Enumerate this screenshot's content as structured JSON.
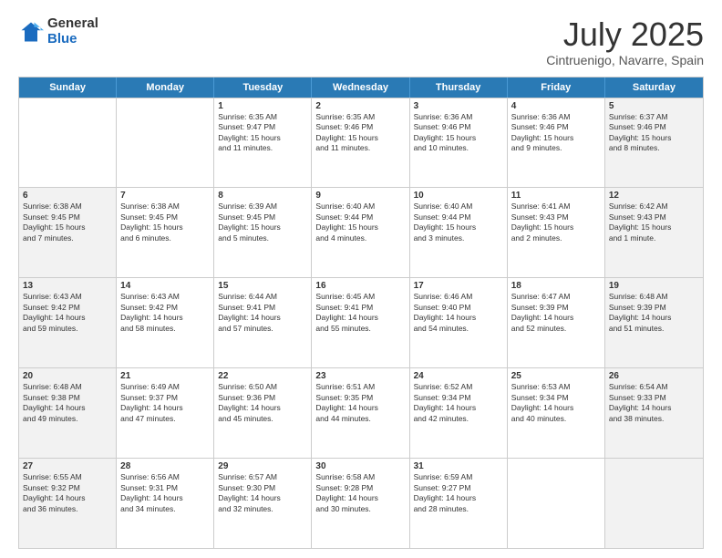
{
  "logo": {
    "general": "General",
    "blue": "Blue"
  },
  "title": "July 2025",
  "subtitle": "Cintruenigo, Navarre, Spain",
  "weekdays": [
    "Sunday",
    "Monday",
    "Tuesday",
    "Wednesday",
    "Thursday",
    "Friday",
    "Saturday"
  ],
  "weeks": [
    [
      {
        "day": "",
        "info": "",
        "shaded": false
      },
      {
        "day": "",
        "info": "",
        "shaded": false
      },
      {
        "day": "1",
        "info": "Sunrise: 6:35 AM\nSunset: 9:47 PM\nDaylight: 15 hours\nand 11 minutes.",
        "shaded": false
      },
      {
        "day": "2",
        "info": "Sunrise: 6:35 AM\nSunset: 9:46 PM\nDaylight: 15 hours\nand 11 minutes.",
        "shaded": false
      },
      {
        "day": "3",
        "info": "Sunrise: 6:36 AM\nSunset: 9:46 PM\nDaylight: 15 hours\nand 10 minutes.",
        "shaded": false
      },
      {
        "day": "4",
        "info": "Sunrise: 6:36 AM\nSunset: 9:46 PM\nDaylight: 15 hours\nand 9 minutes.",
        "shaded": false
      },
      {
        "day": "5",
        "info": "Sunrise: 6:37 AM\nSunset: 9:46 PM\nDaylight: 15 hours\nand 8 minutes.",
        "shaded": true
      }
    ],
    [
      {
        "day": "6",
        "info": "Sunrise: 6:38 AM\nSunset: 9:45 PM\nDaylight: 15 hours\nand 7 minutes.",
        "shaded": true
      },
      {
        "day": "7",
        "info": "Sunrise: 6:38 AM\nSunset: 9:45 PM\nDaylight: 15 hours\nand 6 minutes.",
        "shaded": false
      },
      {
        "day": "8",
        "info": "Sunrise: 6:39 AM\nSunset: 9:45 PM\nDaylight: 15 hours\nand 5 minutes.",
        "shaded": false
      },
      {
        "day": "9",
        "info": "Sunrise: 6:40 AM\nSunset: 9:44 PM\nDaylight: 15 hours\nand 4 minutes.",
        "shaded": false
      },
      {
        "day": "10",
        "info": "Sunrise: 6:40 AM\nSunset: 9:44 PM\nDaylight: 15 hours\nand 3 minutes.",
        "shaded": false
      },
      {
        "day": "11",
        "info": "Sunrise: 6:41 AM\nSunset: 9:43 PM\nDaylight: 15 hours\nand 2 minutes.",
        "shaded": false
      },
      {
        "day": "12",
        "info": "Sunrise: 6:42 AM\nSunset: 9:43 PM\nDaylight: 15 hours\nand 1 minute.",
        "shaded": true
      }
    ],
    [
      {
        "day": "13",
        "info": "Sunrise: 6:43 AM\nSunset: 9:42 PM\nDaylight: 14 hours\nand 59 minutes.",
        "shaded": true
      },
      {
        "day": "14",
        "info": "Sunrise: 6:43 AM\nSunset: 9:42 PM\nDaylight: 14 hours\nand 58 minutes.",
        "shaded": false
      },
      {
        "day": "15",
        "info": "Sunrise: 6:44 AM\nSunset: 9:41 PM\nDaylight: 14 hours\nand 57 minutes.",
        "shaded": false
      },
      {
        "day": "16",
        "info": "Sunrise: 6:45 AM\nSunset: 9:41 PM\nDaylight: 14 hours\nand 55 minutes.",
        "shaded": false
      },
      {
        "day": "17",
        "info": "Sunrise: 6:46 AM\nSunset: 9:40 PM\nDaylight: 14 hours\nand 54 minutes.",
        "shaded": false
      },
      {
        "day": "18",
        "info": "Sunrise: 6:47 AM\nSunset: 9:39 PM\nDaylight: 14 hours\nand 52 minutes.",
        "shaded": false
      },
      {
        "day": "19",
        "info": "Sunrise: 6:48 AM\nSunset: 9:39 PM\nDaylight: 14 hours\nand 51 minutes.",
        "shaded": true
      }
    ],
    [
      {
        "day": "20",
        "info": "Sunrise: 6:48 AM\nSunset: 9:38 PM\nDaylight: 14 hours\nand 49 minutes.",
        "shaded": true
      },
      {
        "day": "21",
        "info": "Sunrise: 6:49 AM\nSunset: 9:37 PM\nDaylight: 14 hours\nand 47 minutes.",
        "shaded": false
      },
      {
        "day": "22",
        "info": "Sunrise: 6:50 AM\nSunset: 9:36 PM\nDaylight: 14 hours\nand 45 minutes.",
        "shaded": false
      },
      {
        "day": "23",
        "info": "Sunrise: 6:51 AM\nSunset: 9:35 PM\nDaylight: 14 hours\nand 44 minutes.",
        "shaded": false
      },
      {
        "day": "24",
        "info": "Sunrise: 6:52 AM\nSunset: 9:34 PM\nDaylight: 14 hours\nand 42 minutes.",
        "shaded": false
      },
      {
        "day": "25",
        "info": "Sunrise: 6:53 AM\nSunset: 9:34 PM\nDaylight: 14 hours\nand 40 minutes.",
        "shaded": false
      },
      {
        "day": "26",
        "info": "Sunrise: 6:54 AM\nSunset: 9:33 PM\nDaylight: 14 hours\nand 38 minutes.",
        "shaded": true
      }
    ],
    [
      {
        "day": "27",
        "info": "Sunrise: 6:55 AM\nSunset: 9:32 PM\nDaylight: 14 hours\nand 36 minutes.",
        "shaded": true
      },
      {
        "day": "28",
        "info": "Sunrise: 6:56 AM\nSunset: 9:31 PM\nDaylight: 14 hours\nand 34 minutes.",
        "shaded": false
      },
      {
        "day": "29",
        "info": "Sunrise: 6:57 AM\nSunset: 9:30 PM\nDaylight: 14 hours\nand 32 minutes.",
        "shaded": false
      },
      {
        "day": "30",
        "info": "Sunrise: 6:58 AM\nSunset: 9:28 PM\nDaylight: 14 hours\nand 30 minutes.",
        "shaded": false
      },
      {
        "day": "31",
        "info": "Sunrise: 6:59 AM\nSunset: 9:27 PM\nDaylight: 14 hours\nand 28 minutes.",
        "shaded": false
      },
      {
        "day": "",
        "info": "",
        "shaded": false
      },
      {
        "day": "",
        "info": "",
        "shaded": true
      }
    ]
  ]
}
